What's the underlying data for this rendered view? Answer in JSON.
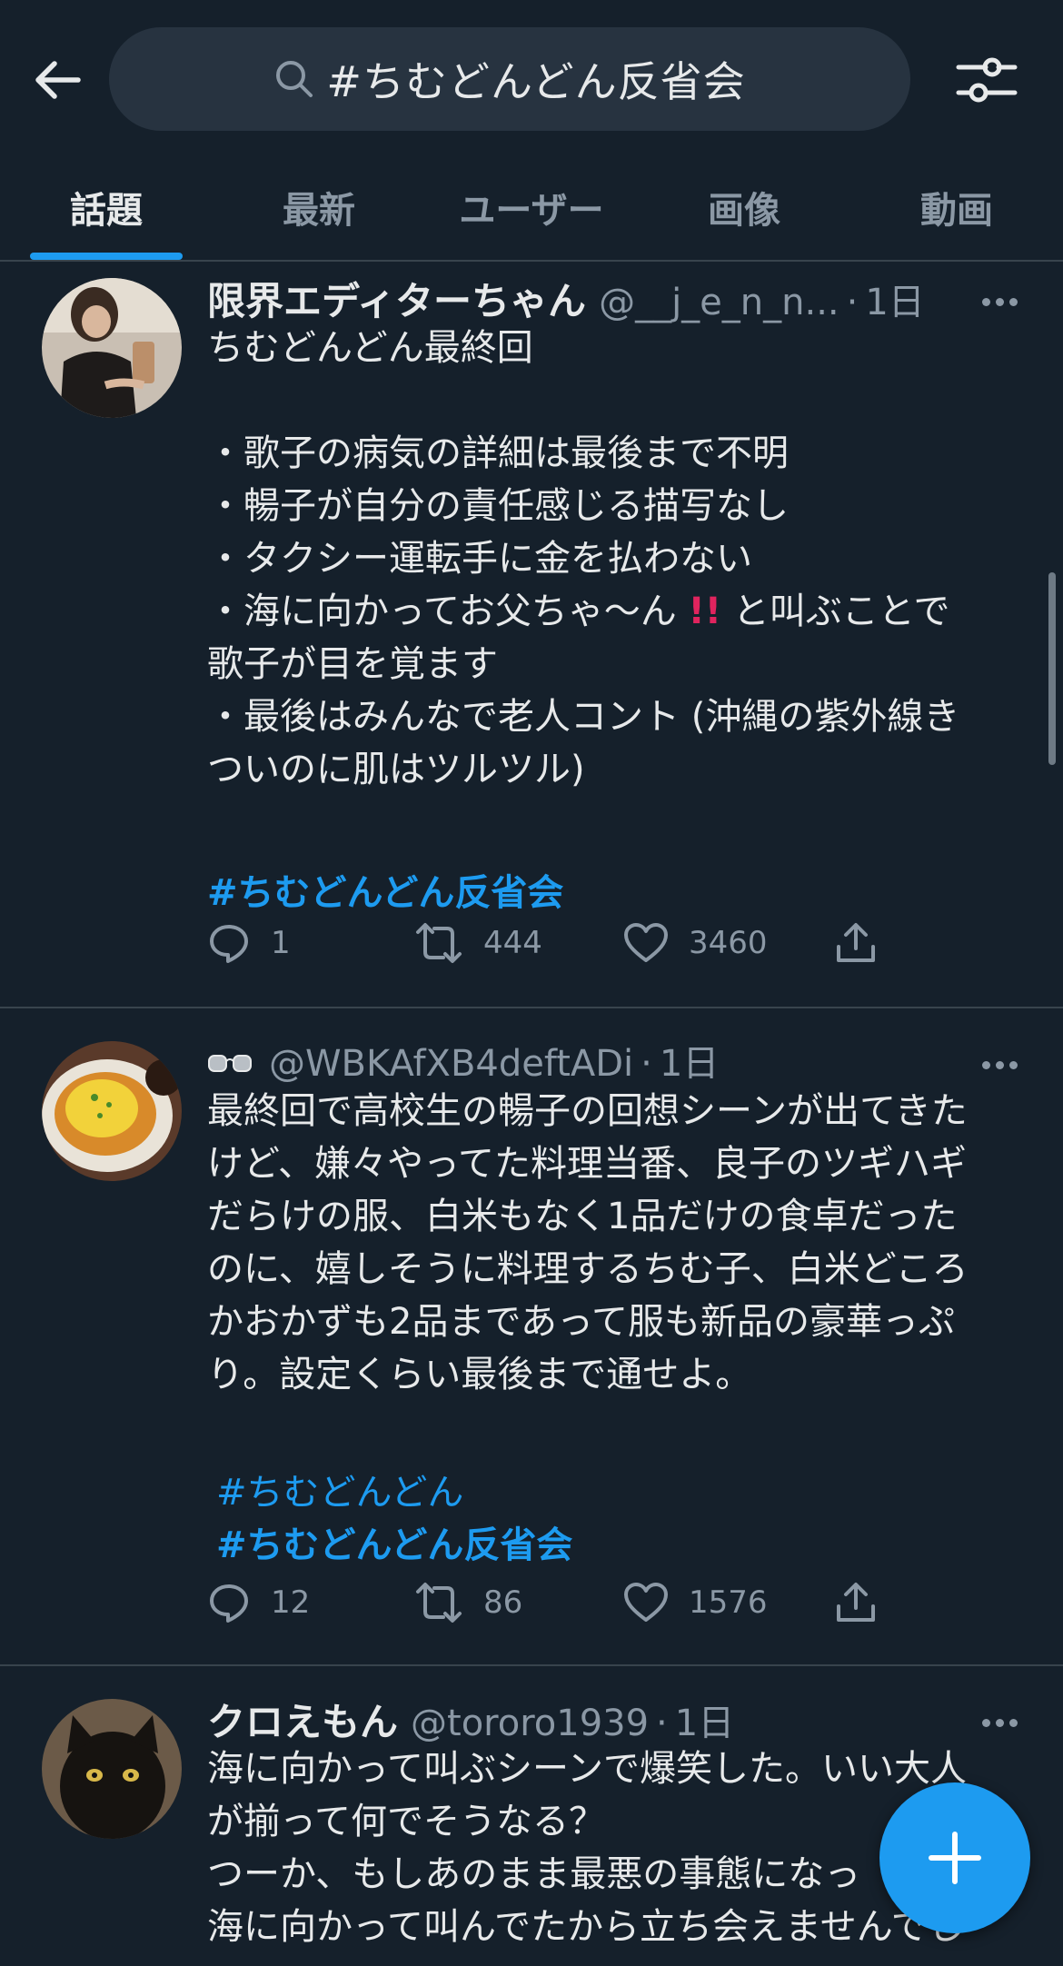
{
  "search": {
    "query": "#ちむどんどん反省会"
  },
  "tabs": [
    {
      "label": "話題",
      "active": true
    },
    {
      "label": "最新"
    },
    {
      "label": "ユーザー"
    },
    {
      "label": "画像"
    },
    {
      "label": "動画"
    }
  ],
  "tweets": [
    {
      "name": "限界エディターちゃん",
      "handle": "@__j_e_n_n...",
      "time": "1日",
      "lines": [
        "ちむどんどん最終回",
        "",
        "・歌子の病気の詳細は最後まで不明",
        "・暢子が自分の責任感じる描写なし",
        "・タクシー運転手に金を払わない",
        "・海に向かってお父ちゃ〜ん",
        "と叫ぶことで",
        "歌子が目を覚ます",
        "・最後はみんなで老人コント (沖縄の紫外線き",
        "ついのに肌はツルツル)"
      ],
      "emoji": "‼️",
      "hashtags": [
        "#ちむどんどん反省会"
      ],
      "replies": "1",
      "retweets": "444",
      "likes": "3460"
    },
    {
      "name": "",
      "emoji_name": "👓",
      "handle": "@WBKAfXB4deftADi",
      "time": "1日",
      "lines": [
        "最終回で高校生の暢子の回想シーンが出てきた",
        "けど、嫌々やってた料理当番、良子のツギハギ",
        "だらけの服、白米もなく1品だけの食卓だった",
        "のに、嬉しそうに料理するちむ子、白米どころ",
        "かおかずも2品まであって服も新品の豪華っぷ",
        "り。設定くらい最後まで通せよ。"
      ],
      "hashtags": [
        "#ちむどんどん",
        "#ちむどんどん反省会"
      ],
      "replies": "12",
      "retweets": "86",
      "likes": "1576"
    },
    {
      "name": "クロえもん",
      "handle": "@tororo1939",
      "time": "1日",
      "lines": [
        "海に向かって叫ぶシーンで爆笑した。いい大人",
        "が揃って何でそうなる？",
        "つーか、もしあのまま最悪の事態になっ",
        "海に向かって叫んでたから立ち会えませんでし"
      ]
    }
  ],
  "colors": {
    "background": "#15202b",
    "accent": "#1d9bf0",
    "secondary_text": "#8b98a5",
    "divider": "#38444d",
    "search_bg": "#273340"
  },
  "icons": [
    "back-arrow-icon",
    "search-icon",
    "filter-sliders-icon",
    "more-dots-icon",
    "reply-icon",
    "retweet-icon",
    "like-icon",
    "share-icon",
    "compose-plus-icon"
  ]
}
